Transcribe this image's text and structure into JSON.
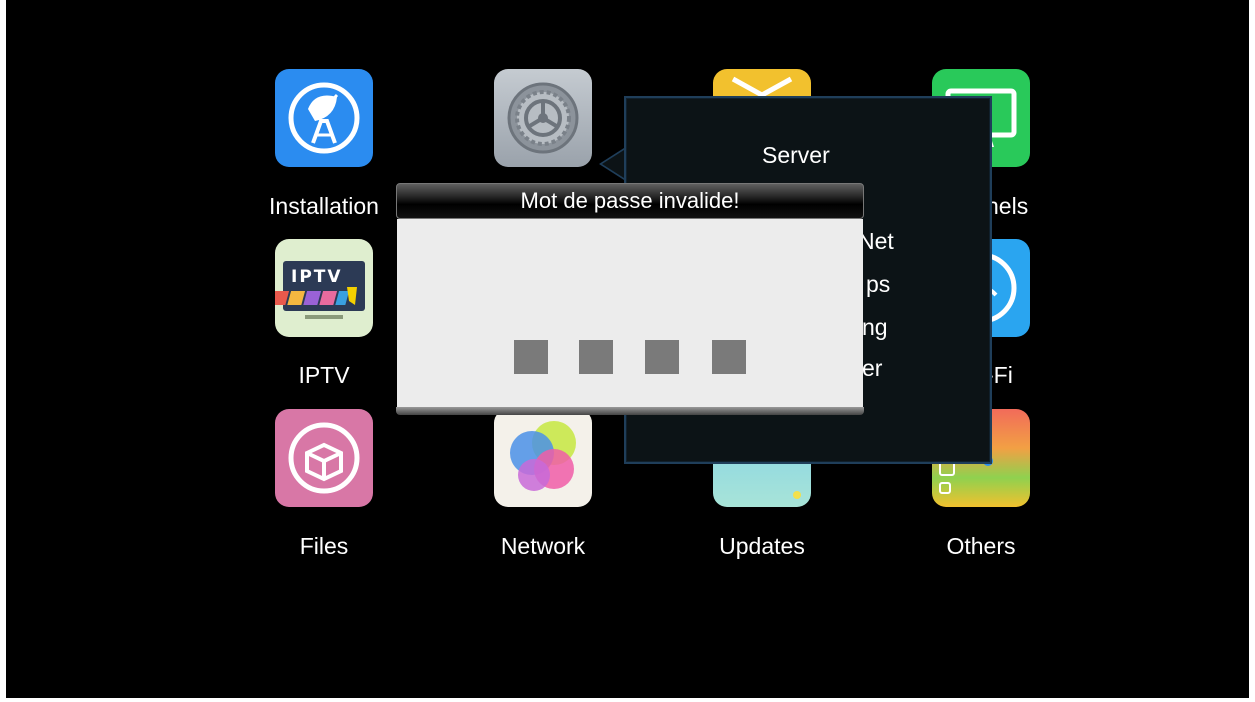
{
  "apps": [
    {
      "id": "installation",
      "label": "Installation",
      "icon": "satellite-dish-icon"
    },
    {
      "id": "system",
      "label": "",
      "icon": "gear-icon"
    },
    {
      "id": "media",
      "label": "",
      "icon": "media-icon"
    },
    {
      "id": "channels",
      "label": "nels",
      "icon": "monitor-icon"
    },
    {
      "id": "iptv",
      "label": "IPTV",
      "icon": "iptv-tv-icon"
    },
    {
      "id": "wifi",
      "label": "-Fi",
      "icon": "wifi-icon"
    },
    {
      "id": "files",
      "label": "Files",
      "icon": "package-box-icon"
    },
    {
      "id": "network",
      "label": "Network",
      "icon": "circles-icon"
    },
    {
      "id": "updates",
      "label": "Updates",
      "icon": "clock-icon"
    },
    {
      "id": "others",
      "label": "Others",
      "icon": "grid-apps-icon"
    }
  ],
  "iptv_badge": "IPTV",
  "submenu": {
    "items": [
      "Server",
      "Net",
      "ps",
      "ng",
      "er"
    ]
  },
  "dialog": {
    "title": "Mot de passe invalide!",
    "pin_length": 4
  },
  "colors": {
    "installation_bg": "#2b8cf0",
    "system_bg": "#a9b0b8",
    "iptv_bg": "#dfeecf",
    "files_bg": "#d877a6",
    "wifi_bg": "#2aa5f0",
    "channels_bg": "#29c95a",
    "media_bg": "#f2c12e"
  }
}
